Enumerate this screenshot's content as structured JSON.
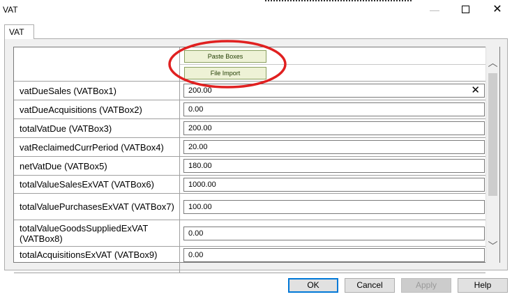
{
  "window": {
    "title": "VAT",
    "controls": {
      "minimize": "—",
      "close": "✕"
    }
  },
  "tabs": [
    {
      "label": "VAT"
    }
  ],
  "grid": {
    "buttons": {
      "paste": "Paste Boxes",
      "import": "File Import"
    },
    "rows": [
      {
        "label": "vatDueSales (VATBox1)",
        "value": "200.00"
      },
      {
        "label": "vatDueAcquisitions (VATBox2)",
        "value": "0.00"
      },
      {
        "label": "totalVatDue (VATBox3)",
        "value": "200.00"
      },
      {
        "label": "vatReclaimedCurrPeriod (VATBox4)",
        "value": "20.00"
      },
      {
        "label": "netVatDue (VATBox5)",
        "value": "180.00"
      },
      {
        "label": "totalValueSalesExVAT (VATBox6)",
        "value": "1000.00"
      },
      {
        "label": "totalValuePurchasesExVAT (VATBox7)",
        "value": "100.00"
      },
      {
        "label": "totalValueGoodsSuppliedExVAT (VATBox8)",
        "value": "0.00"
      },
      {
        "label": "totalAcquisitionsExVAT (VATBox9)",
        "value": "0.00"
      }
    ],
    "clear_icon": "✕",
    "scroll_up": "︿",
    "scroll_down": "﹀"
  },
  "footer": {
    "ok": "OK",
    "cancel": "Cancel",
    "apply": "Apply",
    "help": "Help"
  },
  "colors": {
    "annotation": "#e02020",
    "button_fill": "#eef2d6",
    "ok_border": "#0078d7"
  }
}
